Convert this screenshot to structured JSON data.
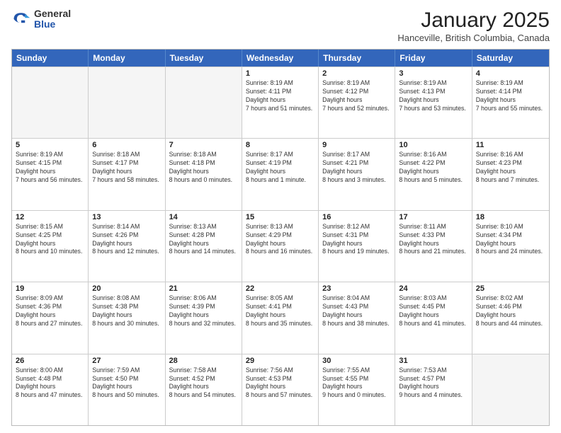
{
  "header": {
    "logo": {
      "general": "General",
      "blue": "Blue"
    },
    "title": "January 2025",
    "location": "Hanceville, British Columbia, Canada"
  },
  "days": [
    "Sunday",
    "Monday",
    "Tuesday",
    "Wednesday",
    "Thursday",
    "Friday",
    "Saturday"
  ],
  "weeks": [
    [
      {
        "date": "",
        "empty": true
      },
      {
        "date": "",
        "empty": true
      },
      {
        "date": "",
        "empty": true
      },
      {
        "date": "1",
        "sunrise": "8:19 AM",
        "sunset": "4:11 PM",
        "daylight": "7 hours and 51 minutes."
      },
      {
        "date": "2",
        "sunrise": "8:19 AM",
        "sunset": "4:12 PM",
        "daylight": "7 hours and 52 minutes."
      },
      {
        "date": "3",
        "sunrise": "8:19 AM",
        "sunset": "4:13 PM",
        "daylight": "7 hours and 53 minutes."
      },
      {
        "date": "4",
        "sunrise": "8:19 AM",
        "sunset": "4:14 PM",
        "daylight": "7 hours and 55 minutes."
      }
    ],
    [
      {
        "date": "5",
        "sunrise": "8:19 AM",
        "sunset": "4:15 PM",
        "daylight": "7 hours and 56 minutes."
      },
      {
        "date": "6",
        "sunrise": "8:18 AM",
        "sunset": "4:17 PM",
        "daylight": "7 hours and 58 minutes."
      },
      {
        "date": "7",
        "sunrise": "8:18 AM",
        "sunset": "4:18 PM",
        "daylight": "8 hours and 0 minutes."
      },
      {
        "date": "8",
        "sunrise": "8:17 AM",
        "sunset": "4:19 PM",
        "daylight": "8 hours and 1 minute."
      },
      {
        "date": "9",
        "sunrise": "8:17 AM",
        "sunset": "4:21 PM",
        "daylight": "8 hours and 3 minutes."
      },
      {
        "date": "10",
        "sunrise": "8:16 AM",
        "sunset": "4:22 PM",
        "daylight": "8 hours and 5 minutes."
      },
      {
        "date": "11",
        "sunrise": "8:16 AM",
        "sunset": "4:23 PM",
        "daylight": "8 hours and 7 minutes."
      }
    ],
    [
      {
        "date": "12",
        "sunrise": "8:15 AM",
        "sunset": "4:25 PM",
        "daylight": "8 hours and 10 minutes."
      },
      {
        "date": "13",
        "sunrise": "8:14 AM",
        "sunset": "4:26 PM",
        "daylight": "8 hours and 12 minutes."
      },
      {
        "date": "14",
        "sunrise": "8:13 AM",
        "sunset": "4:28 PM",
        "daylight": "8 hours and 14 minutes."
      },
      {
        "date": "15",
        "sunrise": "8:13 AM",
        "sunset": "4:29 PM",
        "daylight": "8 hours and 16 minutes."
      },
      {
        "date": "16",
        "sunrise": "8:12 AM",
        "sunset": "4:31 PM",
        "daylight": "8 hours and 19 minutes."
      },
      {
        "date": "17",
        "sunrise": "8:11 AM",
        "sunset": "4:33 PM",
        "daylight": "8 hours and 21 minutes."
      },
      {
        "date": "18",
        "sunrise": "8:10 AM",
        "sunset": "4:34 PM",
        "daylight": "8 hours and 24 minutes."
      }
    ],
    [
      {
        "date": "19",
        "sunrise": "8:09 AM",
        "sunset": "4:36 PM",
        "daylight": "8 hours and 27 minutes."
      },
      {
        "date": "20",
        "sunrise": "8:08 AM",
        "sunset": "4:38 PM",
        "daylight": "8 hours and 30 minutes."
      },
      {
        "date": "21",
        "sunrise": "8:06 AM",
        "sunset": "4:39 PM",
        "daylight": "8 hours and 32 minutes."
      },
      {
        "date": "22",
        "sunrise": "8:05 AM",
        "sunset": "4:41 PM",
        "daylight": "8 hours and 35 minutes."
      },
      {
        "date": "23",
        "sunrise": "8:04 AM",
        "sunset": "4:43 PM",
        "daylight": "8 hours and 38 minutes."
      },
      {
        "date": "24",
        "sunrise": "8:03 AM",
        "sunset": "4:45 PM",
        "daylight": "8 hours and 41 minutes."
      },
      {
        "date": "25",
        "sunrise": "8:02 AM",
        "sunset": "4:46 PM",
        "daylight": "8 hours and 44 minutes."
      }
    ],
    [
      {
        "date": "26",
        "sunrise": "8:00 AM",
        "sunset": "4:48 PM",
        "daylight": "8 hours and 47 minutes."
      },
      {
        "date": "27",
        "sunrise": "7:59 AM",
        "sunset": "4:50 PM",
        "daylight": "8 hours and 50 minutes."
      },
      {
        "date": "28",
        "sunrise": "7:58 AM",
        "sunset": "4:52 PM",
        "daylight": "8 hours and 54 minutes."
      },
      {
        "date": "29",
        "sunrise": "7:56 AM",
        "sunset": "4:53 PM",
        "daylight": "8 hours and 57 minutes."
      },
      {
        "date": "30",
        "sunrise": "7:55 AM",
        "sunset": "4:55 PM",
        "daylight": "9 hours and 0 minutes."
      },
      {
        "date": "31",
        "sunrise": "7:53 AM",
        "sunset": "4:57 PM",
        "daylight": "9 hours and 4 minutes."
      },
      {
        "date": "",
        "empty": true
      }
    ]
  ],
  "labels": {
    "sunrise_prefix": "Sunrise: ",
    "sunset_prefix": "Sunset: ",
    "daylight_label": "Daylight hours"
  }
}
